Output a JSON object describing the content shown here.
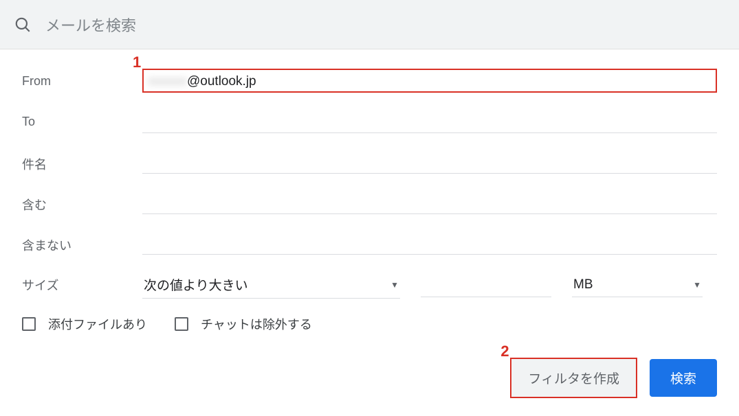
{
  "searchbar": {
    "placeholder": "メールを検索"
  },
  "form": {
    "from": {
      "label": "From",
      "value_obscured": "xxxxxx",
      "value_clear": "@outlook.jp"
    },
    "to": {
      "label": "To"
    },
    "subject": {
      "label": "件名"
    },
    "includes": {
      "label": "含む"
    },
    "excludes": {
      "label": "含まない"
    },
    "size": {
      "label": "サイズ",
      "compare": "次の値より大きい",
      "unit": "MB"
    }
  },
  "checkboxes": {
    "has_attachment": "添付ファイルあり",
    "exclude_chat": "チャットは除外する"
  },
  "buttons": {
    "create_filter": "フィルタを作成",
    "search": "検索"
  },
  "annotations": {
    "one": "1",
    "two": "2"
  }
}
